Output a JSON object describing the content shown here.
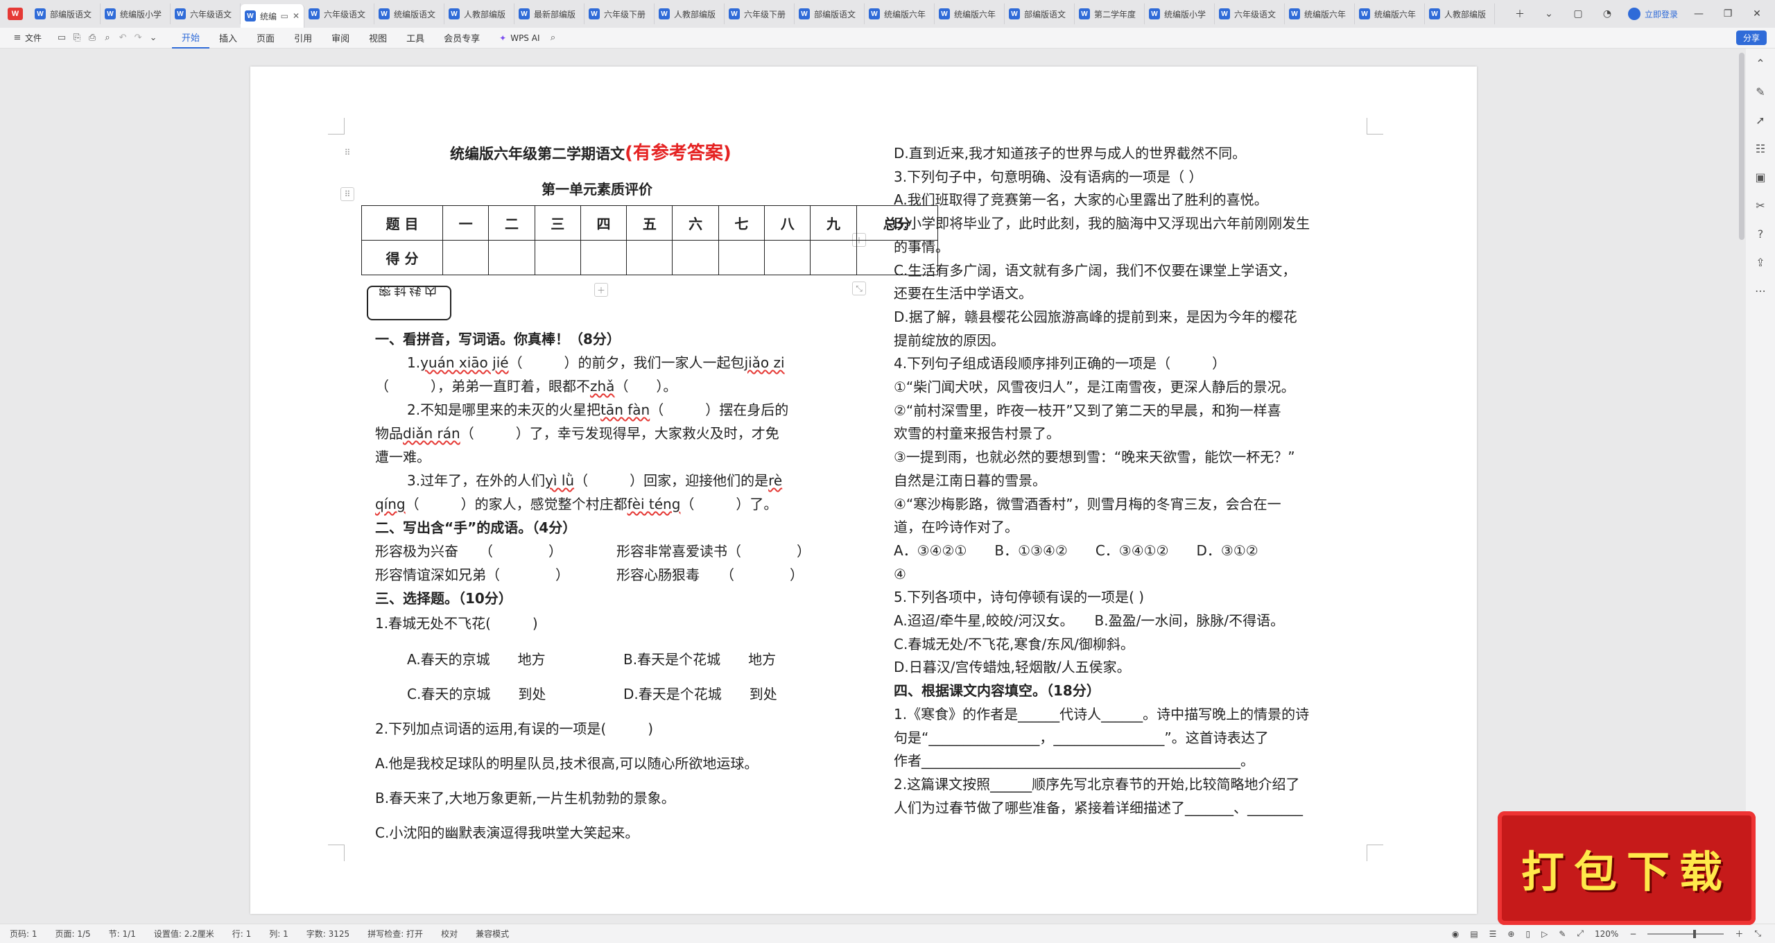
{
  "tabbar": {
    "tabs": [
      {
        "label": "部编版语文"
      },
      {
        "label": "统编版小学"
      },
      {
        "label": "六年级语文"
      },
      {
        "label": "统编",
        "active": true
      },
      {
        "label": "六年级语文"
      },
      {
        "label": "统编版语文"
      },
      {
        "label": "人教部编版"
      },
      {
        "label": "最新部编版"
      },
      {
        "label": "六年级下册"
      },
      {
        "label": "人教部编版"
      },
      {
        "label": "六年级下册"
      },
      {
        "label": "部编版语文"
      },
      {
        "label": "统编版六年"
      },
      {
        "label": "统编版六年"
      },
      {
        "label": "部编版语文"
      },
      {
        "label": "第二学年度"
      },
      {
        "label": "统编版小学"
      },
      {
        "label": "六年级语文"
      },
      {
        "label": "统编版六年"
      },
      {
        "label": "统编版六年"
      },
      {
        "label": "人教部编版"
      }
    ],
    "login_label": "立即登录"
  },
  "toolbar": {
    "file_label": "文件",
    "menu_tabs": [
      "开始",
      "插入",
      "页面",
      "引用",
      "审阅",
      "视图",
      "工具",
      "会员专享"
    ],
    "wps_ai": "WPS AI",
    "share_label": "分享"
  },
  "doc": {
    "title_main": "统编版六年级第二学期语文",
    "title_red": "(有参考答案)",
    "subtitle": "第一单元素质评价",
    "table": {
      "row1": [
        "题 目",
        "一",
        "二",
        "三",
        "四",
        "五",
        "六",
        "七",
        "八",
        "九",
        "总分"
      ],
      "row2_label": "得 分"
    },
    "seal_text": "密封线内",
    "left": {
      "s1": "一、看拼音，写词语。你真棒！（8分）",
      "q1a_pre": "1.",
      "q1a_py1": "yuán xiāo jié",
      "q1a_mid": "（　　　）的前夕，我们一家人一起包",
      "q1a_py2": "jiǎo zi",
      "q1b_pre": "（　　　），弟弟一直盯着，眼都不",
      "q1b_py": "zhǎ",
      "q1b_post": "（　　）。",
      "q2a_pre": "2.不知是哪里来的未灭的火星把",
      "q2a_py": "tān fàn",
      "q2a_post": "（　　　）摆在身后的",
      "q2b_pre": "物品",
      "q2b_py": "diǎn rán",
      "q2b_post": "（　　　）了，幸亏发现得早，大家救火及时，才免",
      "q2c": "遭一难。",
      "q3a_pre": "3.过年了，在外的人们",
      "q3a_py1": "yì lǜ",
      "q3a_mid": "（　　　）回家，迎接他们的是",
      "q3a_py2": "rè",
      "q3b_py1": "qíng",
      "q3b_mid": "（　　　）的家人，感觉整个村庄都",
      "q3b_py2": "fèi téng",
      "q3b_post": "（　　　）了。",
      "s2": "二、写出含“手”的成语。（4分）",
      "i1": "形容极为兴奋　　（　　　　）",
      "i2": "形容非常喜爱读书（　　　　）",
      "i3": "形容情谊深如兄弟（　　　　）",
      "i4": "形容心肠狠毒　　（　　　　）",
      "s3": "三、选择题。（10分）",
      "c1": "1.春城无处不飞花(　　　)",
      "c1a": "A.春天的京城　　地方",
      "c1b": "B.春天是个花城　　地方",
      "c1c": "C.春天的京城　　到处",
      "c1d": "D.春天是个花城　　到处",
      "c2": "2.下列加点词语的运用,有误的一项是(　　　)",
      "c2a": "A.他是我校足球队的明星队员,技术很高,可以随心所欲地运球。",
      "c2b": "B.春天来了,大地万象更新,一片生机勃勃的景象。",
      "c2c": "C.小沈阳的幽默表演逗得我哄堂大笑起来。"
    },
    "right": {
      "r1": "D.直到近来,我才知道孩子的世界与成人的世界截然不同。",
      "r2": "3.下列句子中，句意明确、没有语病的一项是（  ）",
      "r3": "A.我们班取得了竞赛第一名，大家的心里露出了胜利的喜悦。",
      "r4": "B.小学即将毕业了，此时此刻，我的脑海中又浮现出六年前刚刚发生",
      "r5": "的事情。",
      "r6": "C.生活有多广阔，语文就有多广阔，我们不仅要在课堂上学语文，",
      "r7": "还要在生活中学语文。",
      "r8": "D.据了解，赣县樱花公园旅游高峰的提前到来，是因为今年的樱花",
      "r9": "提前绽放的原因。",
      "r10": "4.下列句子组成语段顺序排列正确的一项是（　　　）",
      "r11": "①“柴门闻犬吠，风雪夜归人”，是江南雪夜，更深人静后的景况。",
      "r12": "②“前村深雪里，昨夜一枝开”又到了第二天的早晨，和狗一样喜",
      "r13": "欢雪的村童来报告村景了。",
      "r14": "③一提到雨，也就必然的要想到雪：“晚来天欲雪，能饮一杯无？”",
      "r15": "自然是江南日暮的雪景。",
      "r16": "④“寒沙梅影路，微雪酒香村”，则雪月梅的冬宵三友，会合在一",
      "r17": "道，在吟诗作对了。",
      "r18": "A．③④②①　　B．①③④②　　C．③④①②　　D．③①②",
      "r19": "④",
      "r20": "5.下列各项中，诗句停顿有误的一项是(  )",
      "r21": "A.迢迢/牵牛星,皎皎/河汉女。　　B.盈盈/一水间，脉脉/不得语。",
      "r22": "C.春城无处/不飞花,寒食/东风/御柳斜。",
      "r23": "D.日暮汉/宫传蜡烛,轻烟散/人五侯家。",
      "r24": "四、根据课文内容填空。（18分）",
      "r25": "1.《寒食》的作者是______代诗人______。诗中描写晚上的情景的诗",
      "r26": "句是“________________，________________”。这首诗表达了",
      "r27": "作者______________________________________________。",
      "r28": "2.这篇课文按照______顺序先写北京春节的开始,比较简略地介绍了",
      "r29": "人们为过春节做了哪些准备，紧接着详细描述了_______、________"
    }
  },
  "status": {
    "page": "页码: 1",
    "pages": "页面: 1/5",
    "section": "节: 1/1",
    "setting": "设置值: 2.2厘米",
    "row": "行: 1",
    "col": "列: 1",
    "words": "字数: 3125",
    "spell": "拼写检查: 打开",
    "proof": "校对",
    "compat": "兼容模式",
    "zoom": "120%"
  },
  "promo": {
    "label": "打包下载"
  },
  "colors": {
    "accent": "#2f6bd8",
    "title_red": "#e52222",
    "promo_bg": "#c61a1a",
    "promo_text": "#ffe94a"
  }
}
